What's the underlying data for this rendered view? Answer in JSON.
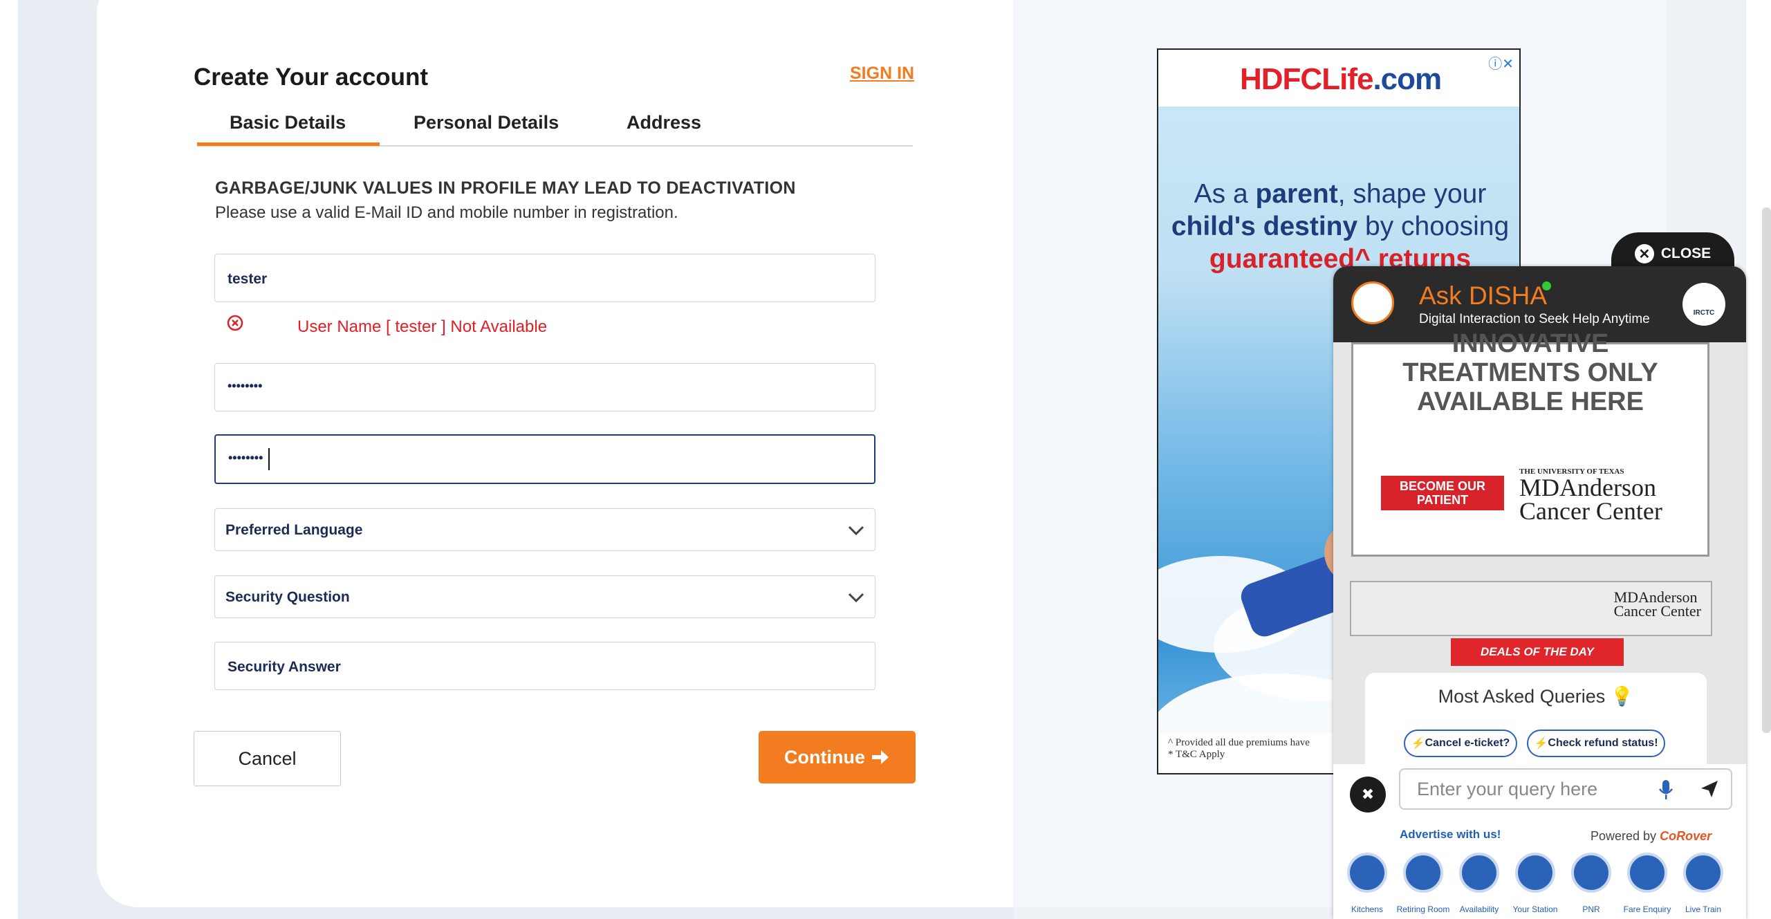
{
  "form": {
    "title": "Create Your account",
    "sign_in": "SIGN IN",
    "tabs": [
      "Basic Details",
      "Personal Details",
      "Address"
    ],
    "active_tab": "Basic Details",
    "warning_title": "GARBAGE/JUNK VALUES IN PROFILE MAY LEAD TO DEACTIVATION",
    "warning_text": "Please use a valid E-Mail ID and mobile number in registration.",
    "username_value": "tester",
    "username_error": "User Name [ tester ] Not Available",
    "password_value": "••••••••",
    "confirm_password_value": "••••••••",
    "preferred_language": "Preferred Language",
    "security_question": "Security Question",
    "security_answer_placeholder": "Security Answer",
    "cancel_label": "Cancel",
    "continue_label": "Continue",
    "accent_color": "#f47c20"
  },
  "ad": {
    "brand": "HDFCLife",
    "brand_suffix": ".com",
    "line1_pre": "As a ",
    "line1_bold": "parent",
    "line1_post": ", shape your",
    "line2_bold": "child's destiny",
    "line2_post": " by choosing",
    "line3": "guaranteed^ returns",
    "footnote1": "^ Provided all due premiums have",
    "footnote2": "* T&C Apply"
  },
  "chatbot": {
    "close_label": "CLOSE",
    "title": "Ask DISHA",
    "subtitle": "Digital Interaction to Seek Help Anytime",
    "irctc_label": "IRCTC",
    "md_headline_1": "INNOVATIVE",
    "md_headline_2": "TREATMENTS ONLY",
    "md_headline_3": "AVAILABLE HERE",
    "md_button": "BECOME OUR PATIENT",
    "md_univ": "THE UNIVERSITY OF TEXAS",
    "md_name_1": "MDAnderson",
    "md_name_2": "Cancer Center",
    "deals": "DEALS OF THE DAY",
    "queries_title": "Most Asked Queries",
    "query_chips": [
      "Cancel e-ticket?",
      "Check refund status!"
    ],
    "input_placeholder": "Enter your query here",
    "advertise": "Advertise with us!",
    "powered_by": "Powered by",
    "powered_brand": "CoRover",
    "quick_links": [
      "Kitchens",
      "Retiring Room",
      "Availability",
      "Your Station",
      "PNR",
      "Fare Enquiry",
      "Live Train"
    ]
  }
}
